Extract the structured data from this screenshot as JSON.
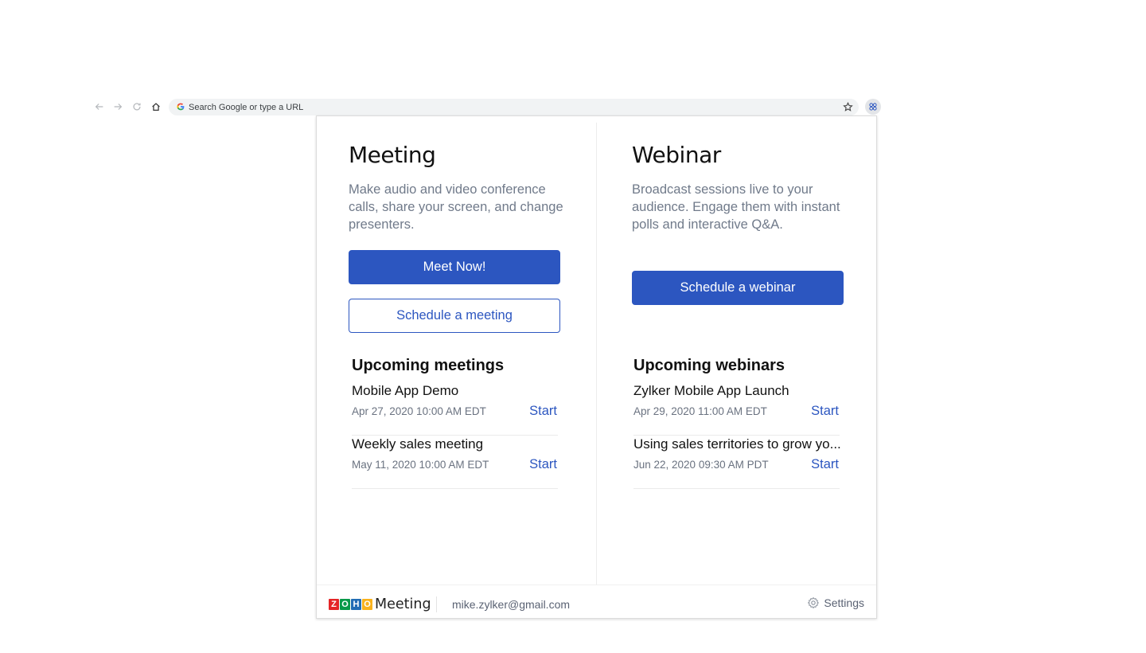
{
  "browser": {
    "omnibox_placeholder": "Search Google or type a URL",
    "icons": [
      "back-arrow-icon",
      "forward-arrow-icon",
      "reload-icon",
      "home-icon",
      "google-g-icon",
      "bookmark-star-icon",
      "extension-icon"
    ]
  },
  "meeting": {
    "title": "Meeting",
    "description": "Make audio and video conference calls, share your screen, and change presenters.",
    "primary_button": "Meet Now!",
    "secondary_button": "Schedule a meeting",
    "upcoming_title": "Upcoming meetings",
    "items": [
      {
        "title": "Mobile App Demo",
        "time": "Apr 27, 2020 10:00 AM EDT",
        "action": "Start"
      },
      {
        "title": "Weekly sales meeting",
        "time": "May 11, 2020 10:00 AM EDT",
        "action": "Start"
      }
    ]
  },
  "webinar": {
    "title": "Webinar",
    "description": "Broadcast sessions live to your audience. Engage them with instant polls and interactive Q&A.",
    "primary_button": "Schedule a webinar",
    "upcoming_title": "Upcoming webinars",
    "items": [
      {
        "title": "Zylker Mobile App Launch",
        "time": "Apr 29, 2020 11:00 AM EDT",
        "action": "Start"
      },
      {
        "title": "Using sales territories to grow yo...",
        "time": "Jun 22, 2020 09:30 AM PDT",
        "action": "Start"
      }
    ]
  },
  "footer": {
    "logo_letters": [
      "Z",
      "O",
      "H",
      "O"
    ],
    "logo_colors": [
      "#e42527",
      "#089949",
      "#226db4",
      "#f9b21d"
    ],
    "brand": "Meeting",
    "email": "mike.zylker@gmail.com",
    "settings_label": "Settings"
  },
  "colors": {
    "accent": "#2c56c0",
    "muted_text": "#707a8a"
  }
}
